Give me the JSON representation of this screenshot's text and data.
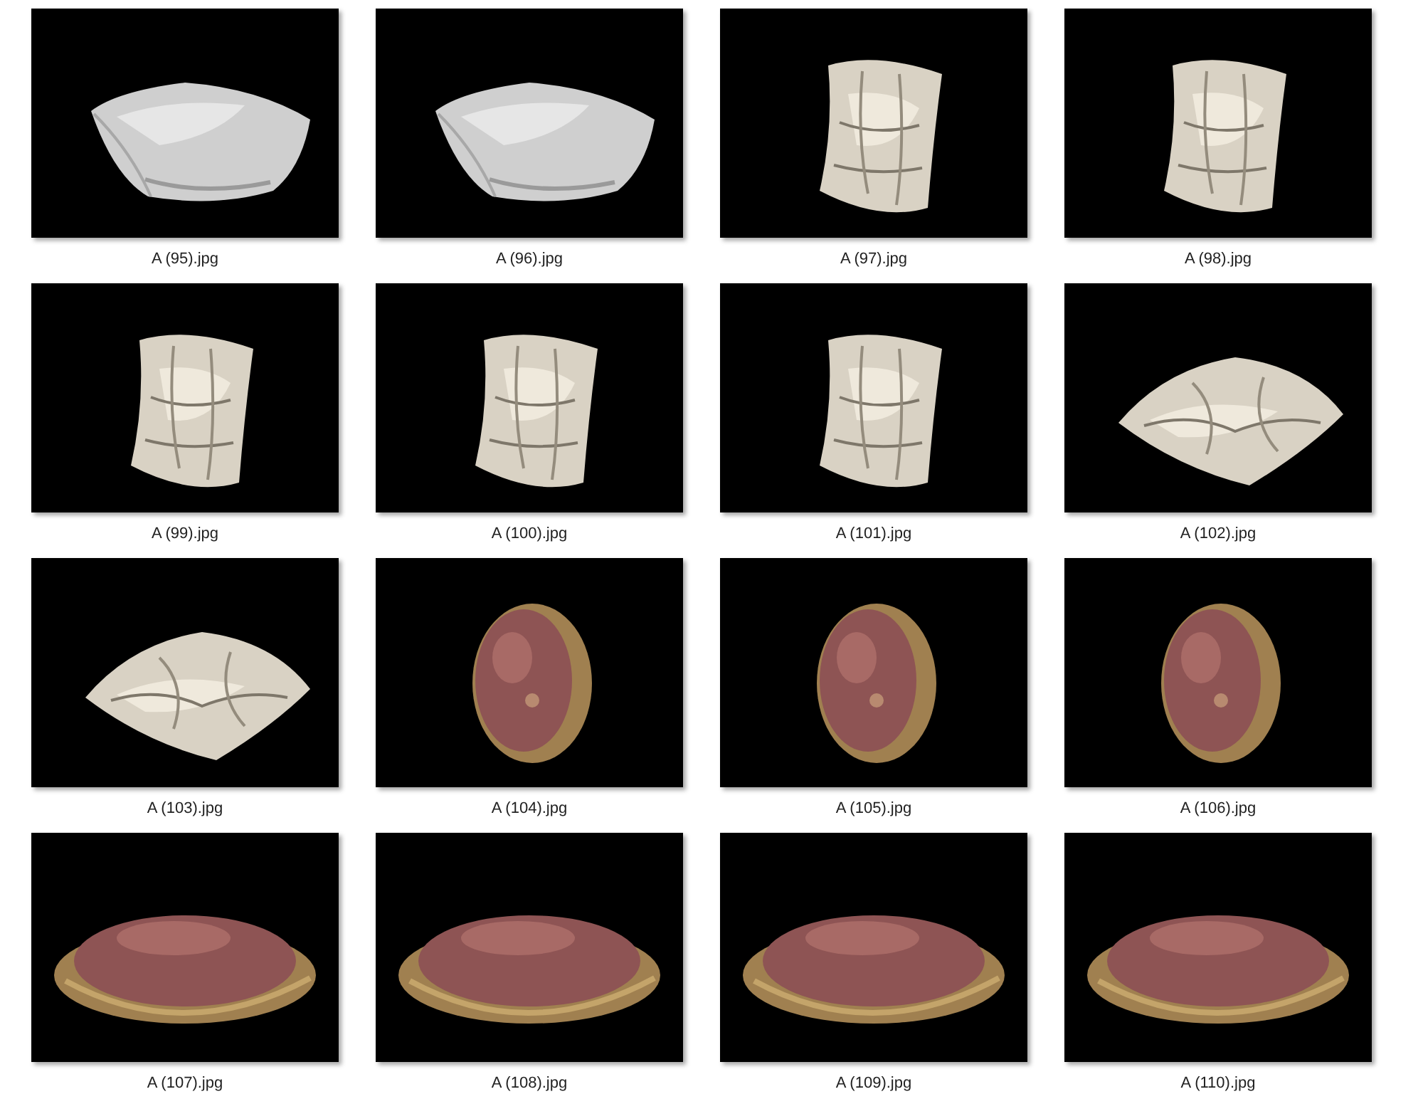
{
  "files": [
    {
      "name": "A (95).jpg",
      "kind": "picture"
    },
    {
      "name": "A (96).jpg",
      "kind": "picture"
    },
    {
      "name": "A (97).jpg",
      "kind": "picture"
    },
    {
      "name": "A (98).jpg",
      "kind": "picture"
    },
    {
      "name": "A (99).jpg",
      "kind": "picture"
    },
    {
      "name": "A (100).jpg",
      "kind": "picture"
    },
    {
      "name": "A (101).jpg",
      "kind": "picture"
    },
    {
      "name": "A (102).jpg",
      "kind": "picture"
    },
    {
      "name": "A (103).jpg",
      "kind": "picture"
    },
    {
      "name": "A (104).jpg",
      "kind": "picture"
    },
    {
      "name": "A (105).jpg",
      "kind": "picture"
    },
    {
      "name": "A (106).jpg",
      "kind": "picture"
    },
    {
      "name": "A (107).jpg",
      "kind": "picture"
    },
    {
      "name": "A (108).jpg",
      "kind": "picture"
    },
    {
      "name": "A (109).jpg",
      "kind": "picture"
    },
    {
      "name": "A (110).jpg",
      "kind": "picture"
    }
  ]
}
